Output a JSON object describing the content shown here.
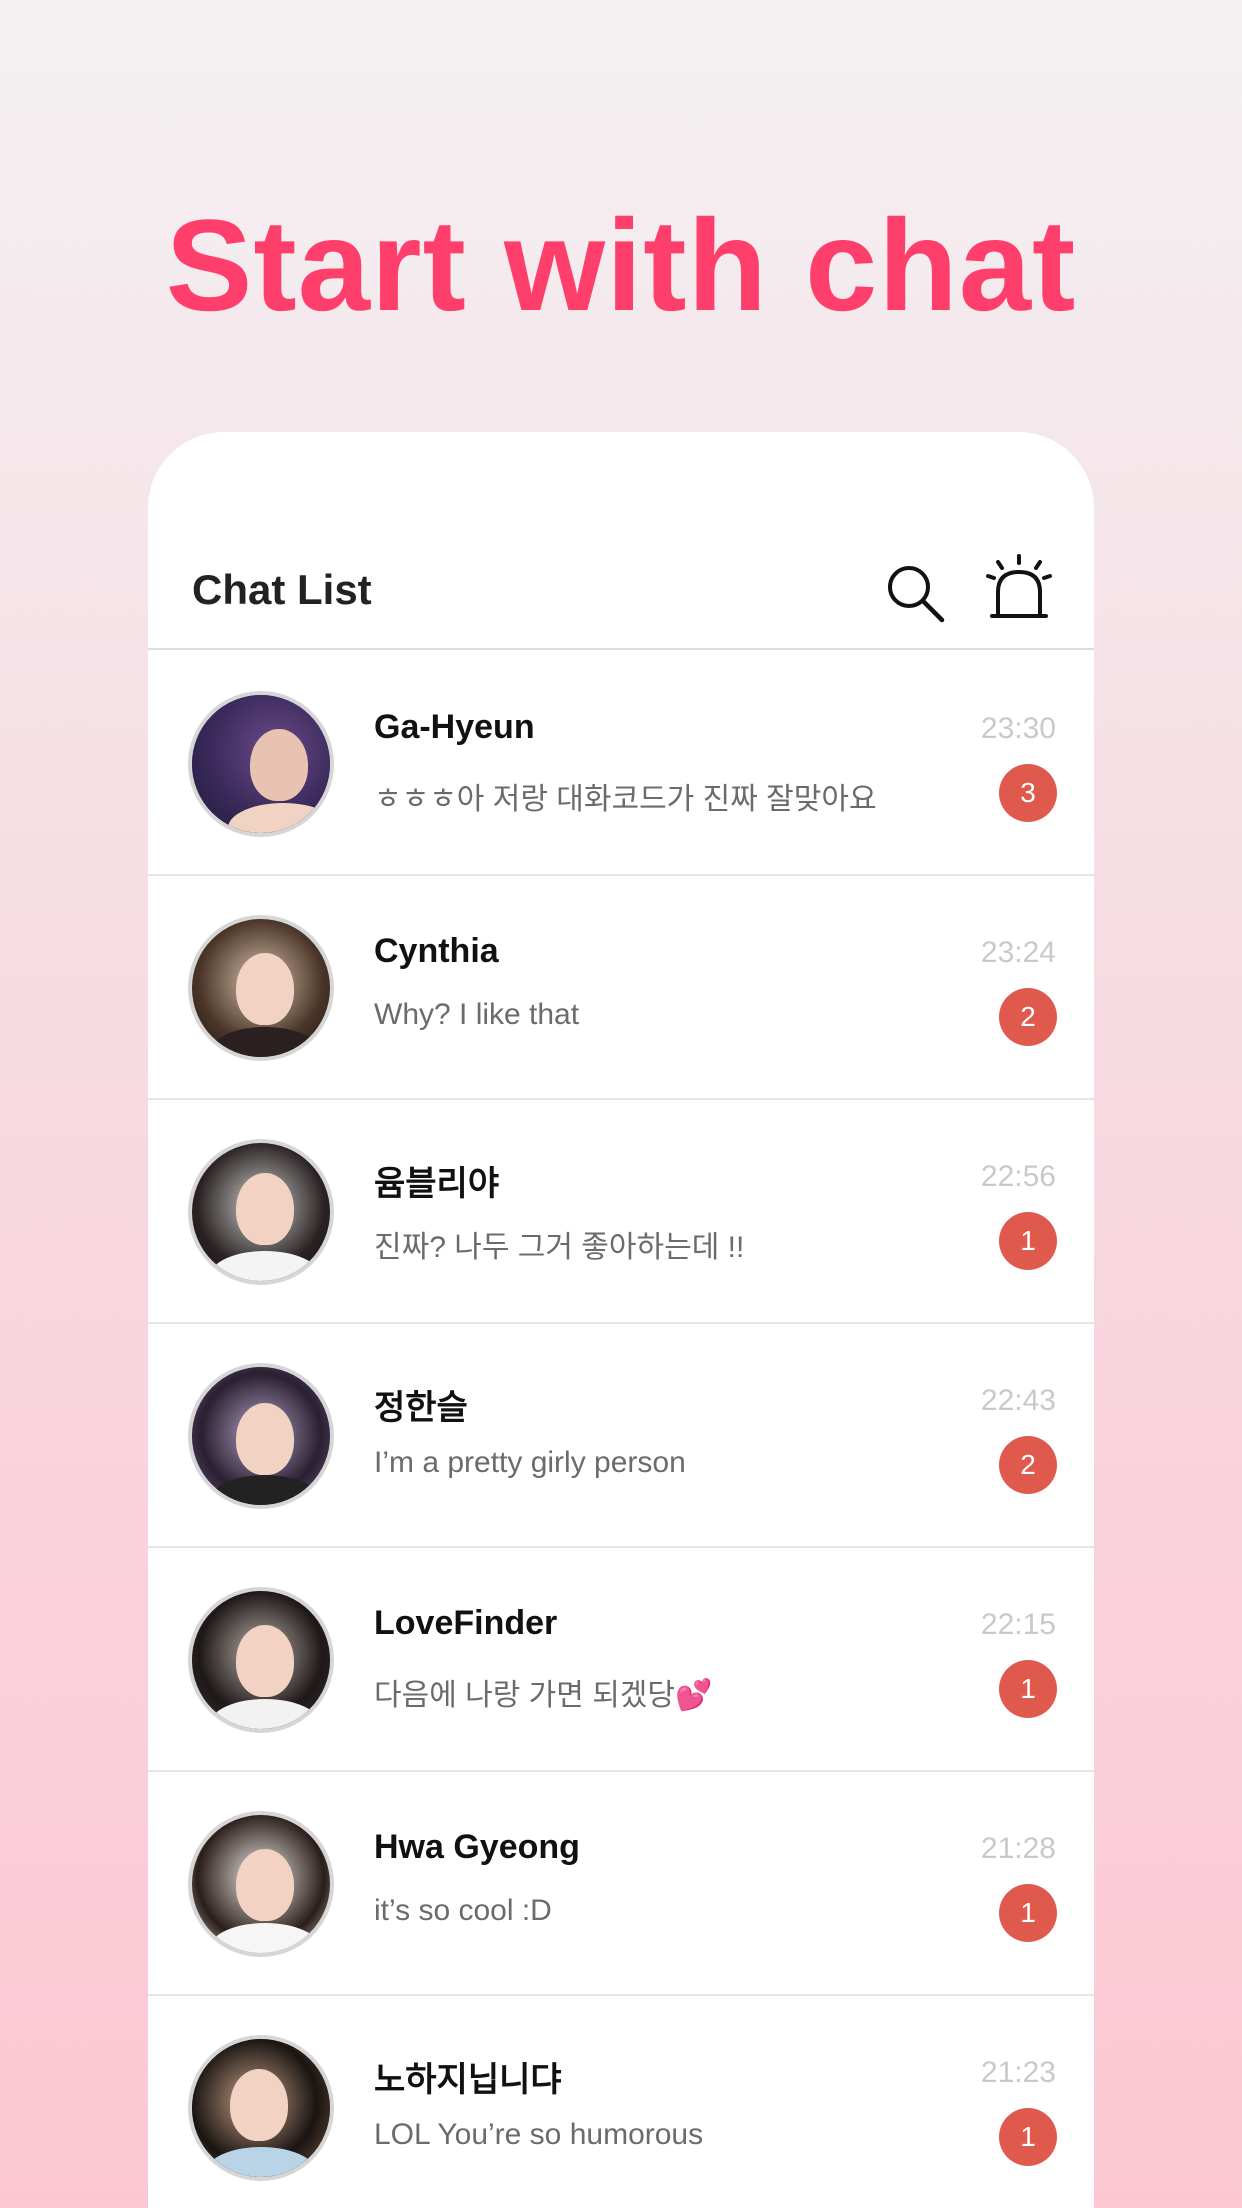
{
  "headline": "Start with chat",
  "header": {
    "title": "Chat List",
    "search_icon": "search-icon",
    "alarm_icon": "alarm-siren-icon"
  },
  "colors": {
    "accent": "#ff3f6b",
    "badge": "#e0594d",
    "background_top": "#f3f1f2",
    "background_bottom": "#fcc7d3"
  },
  "chats": [
    {
      "name": "Ga-Hyeun",
      "message": "ㅎㅎㅎ아 저랑 대화코드가 진짜 잘맞아요",
      "time": "23:30",
      "unread": "3"
    },
    {
      "name": "Cynthia",
      "message": "Why? I like that",
      "time": "23:24",
      "unread": "2"
    },
    {
      "name": "윰블리야",
      "message": "진짜? 나두 그거 좋아하는데 !!",
      "time": "22:56",
      "unread": "1"
    },
    {
      "name": "정한슬",
      "message": "I’m a pretty girly person",
      "time": "22:43",
      "unread": "2"
    },
    {
      "name": "LoveFinder",
      "message": "다음에 나랑 가면 되겠당💕",
      "time": "22:15",
      "unread": "1"
    },
    {
      "name": "Hwa Gyeong",
      "message": "it’s so cool :D",
      "time": "21:28",
      "unread": "1"
    },
    {
      "name": "노하지닙니댜",
      "message": "LOL You’re so humorous",
      "time": "21:23",
      "unread": "1"
    }
  ]
}
